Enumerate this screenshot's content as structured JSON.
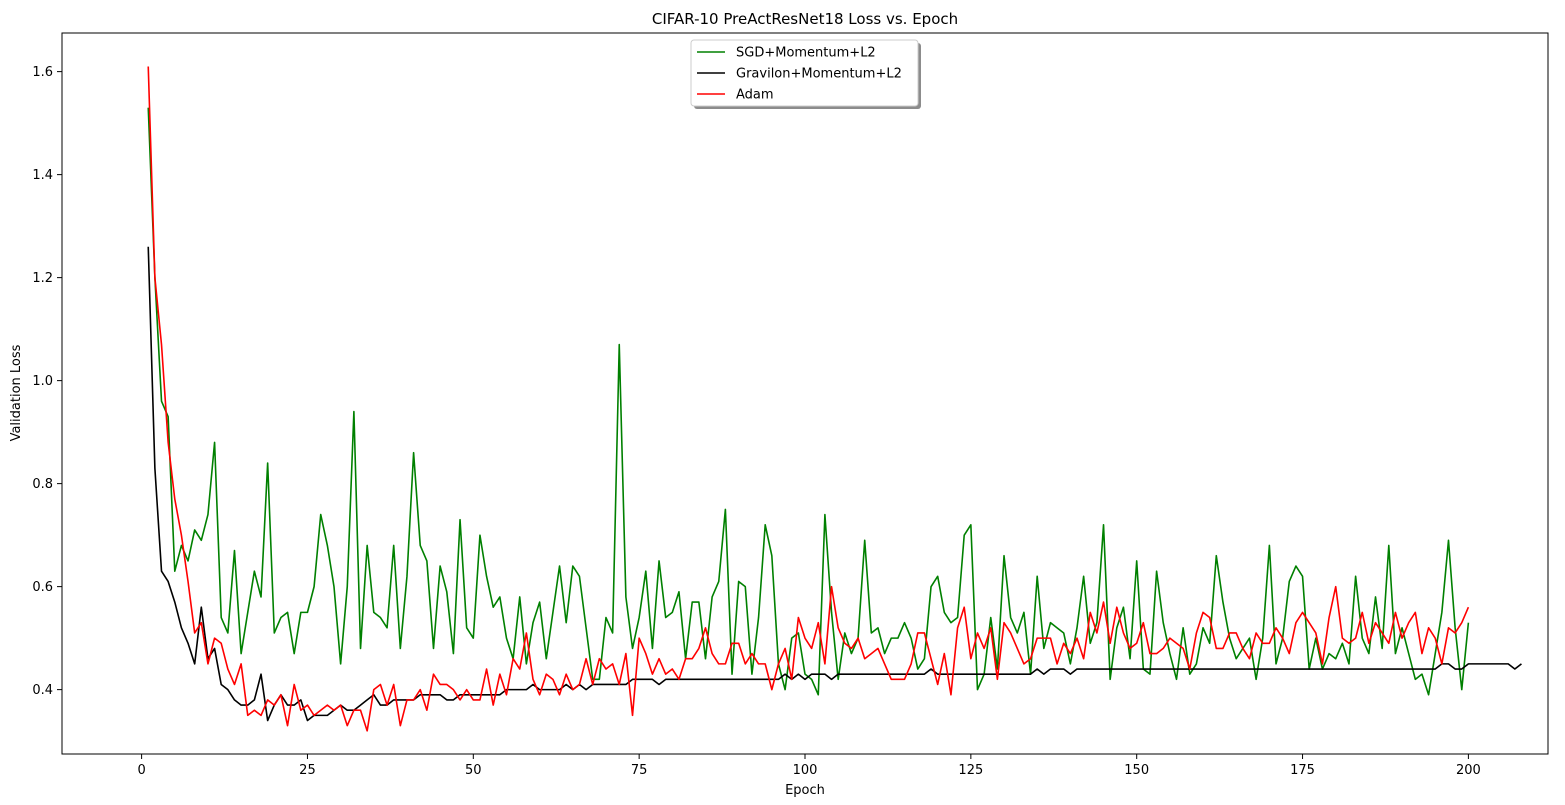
{
  "chart_data": {
    "type": "line",
    "title": "CIFAR-10 PreActResNet18 Loss vs. Epoch",
    "xlabel": "Epoch",
    "ylabel": "Validation Loss",
    "xlim": [
      -12,
      212
    ],
    "ylim": [
      0.275,
      1.675
    ],
    "x_ticks": [
      0,
      25,
      50,
      75,
      100,
      125,
      150,
      175,
      200
    ],
    "y_ticks": [
      0.4,
      0.6,
      0.8,
      1.0,
      1.2,
      1.4,
      1.6
    ],
    "grid": false,
    "legend_position": "upper-center",
    "series": [
      {
        "name": "SGD+Momentum+L2",
        "color": "#008000",
        "x_start": 1,
        "values": [
          1.53,
          1.2,
          0.96,
          0.93,
          0.63,
          0.68,
          0.65,
          0.71,
          0.69,
          0.74,
          0.88,
          0.54,
          0.51,
          0.67,
          0.47,
          0.55,
          0.63,
          0.58,
          0.84,
          0.51,
          0.54,
          0.55,
          0.47,
          0.55,
          0.55,
          0.6,
          0.74,
          0.68,
          0.6,
          0.45,
          0.6,
          0.94,
          0.48,
          0.68,
          0.55,
          0.54,
          0.52,
          0.68,
          0.48,
          0.62,
          0.86,
          0.68,
          0.65,
          0.48,
          0.64,
          0.59,
          0.47,
          0.73,
          0.52,
          0.5,
          0.7,
          0.62,
          0.56,
          0.58,
          0.5,
          0.46,
          0.58,
          0.45,
          0.53,
          0.57,
          0.46,
          0.55,
          0.64,
          0.53,
          0.64,
          0.62,
          0.52,
          0.42,
          0.42,
          0.54,
          0.51,
          1.07,
          0.58,
          0.48,
          0.54,
          0.63,
          0.48,
          0.65,
          0.54,
          0.55,
          0.59,
          0.46,
          0.57,
          0.57,
          0.46,
          0.58,
          0.61,
          0.75,
          0.43,
          0.61,
          0.6,
          0.43,
          0.54,
          0.72,
          0.66,
          0.45,
          0.4,
          0.5,
          0.51,
          0.43,
          0.42,
          0.39,
          0.74,
          0.55,
          0.42,
          0.51,
          0.47,
          0.5,
          0.69,
          0.51,
          0.52,
          0.47,
          0.5,
          0.5,
          0.53,
          0.5,
          0.44,
          0.46,
          0.6,
          0.62,
          0.55,
          0.53,
          0.54,
          0.7,
          0.72,
          0.4,
          0.43,
          0.54,
          0.44,
          0.66,
          0.54,
          0.51,
          0.55,
          0.43,
          0.62,
          0.48,
          0.53,
          0.52,
          0.51,
          0.45,
          0.52,
          0.62,
          0.49,
          0.53,
          0.72,
          0.42,
          0.52,
          0.56,
          0.46,
          0.65,
          0.44,
          0.43,
          0.63,
          0.53,
          0.47,
          0.42,
          0.52,
          0.43,
          0.45,
          0.52,
          0.49,
          0.66,
          0.57,
          0.5,
          0.46,
          0.48,
          0.5,
          0.42,
          0.5,
          0.68,
          0.45,
          0.5,
          0.61,
          0.64,
          0.62,
          0.44,
          0.5,
          0.44,
          0.47,
          0.46,
          0.49,
          0.45,
          0.62,
          0.5,
          0.47,
          0.58,
          0.48,
          0.68,
          0.47,
          0.52,
          0.47,
          0.42,
          0.43,
          0.39,
          0.47,
          0.55,
          0.69,
          0.52,
          0.4,
          0.53
        ]
      },
      {
        "name": "Gravilon+Momentum+L2",
        "color": "#000000",
        "x_start": 1,
        "values": [
          1.26,
          0.83,
          0.63,
          0.61,
          0.57,
          0.52,
          0.49,
          0.45,
          0.56,
          0.46,
          0.48,
          0.41,
          0.4,
          0.38,
          0.37,
          0.37,
          0.38,
          0.43,
          0.34,
          0.37,
          0.39,
          0.37,
          0.37,
          0.38,
          0.34,
          0.35,
          0.35,
          0.35,
          0.36,
          0.37,
          0.36,
          0.36,
          0.37,
          0.38,
          0.39,
          0.37,
          0.37,
          0.38,
          0.38,
          0.38,
          0.38,
          0.39,
          0.39,
          0.39,
          0.39,
          0.38,
          0.38,
          0.39,
          0.39,
          0.39,
          0.39,
          0.39,
          0.39,
          0.39,
          0.4,
          0.4,
          0.4,
          0.4,
          0.41,
          0.4,
          0.4,
          0.4,
          0.4,
          0.41,
          0.4,
          0.41,
          0.4,
          0.41,
          0.41,
          0.41,
          0.41,
          0.41,
          0.41,
          0.42,
          0.42,
          0.42,
          0.42,
          0.41,
          0.42,
          0.42,
          0.42,
          0.42,
          0.42,
          0.42,
          0.42,
          0.42,
          0.42,
          0.42,
          0.42,
          0.42,
          0.42,
          0.42,
          0.42,
          0.42,
          0.42,
          0.42,
          0.43,
          0.42,
          0.43,
          0.42,
          0.43,
          0.43,
          0.43,
          0.42,
          0.43,
          0.43,
          0.43,
          0.43,
          0.43,
          0.43,
          0.43,
          0.43,
          0.43,
          0.43,
          0.43,
          0.43,
          0.43,
          0.43,
          0.44,
          0.43,
          0.43,
          0.43,
          0.43,
          0.43,
          0.43,
          0.43,
          0.43,
          0.43,
          0.43,
          0.43,
          0.43,
          0.43,
          0.43,
          0.43,
          0.44,
          0.43,
          0.44,
          0.44,
          0.44,
          0.43,
          0.44,
          0.44,
          0.44,
          0.44,
          0.44,
          0.44,
          0.44,
          0.44,
          0.44,
          0.44,
          0.44,
          0.44,
          0.44,
          0.44,
          0.44,
          0.44,
          0.44,
          0.44,
          0.44,
          0.44,
          0.44,
          0.44,
          0.44,
          0.44,
          0.44,
          0.44,
          0.44,
          0.44,
          0.44,
          0.44,
          0.44,
          0.44,
          0.44,
          0.44,
          0.44,
          0.44,
          0.44,
          0.44,
          0.44,
          0.44,
          0.44,
          0.44,
          0.44,
          0.44,
          0.44,
          0.44,
          0.44,
          0.44,
          0.44,
          0.44,
          0.44,
          0.44,
          0.44,
          0.44,
          0.44,
          0.45,
          0.45,
          0.44,
          0.44,
          0.45,
          0.45,
          0.45,
          0.45,
          0.45,
          0.45,
          0.45,
          0.44,
          0.45
        ]
      },
      {
        "name": "Adam",
        "color": "#ff0000",
        "x_start": 1,
        "values": [
          1.61,
          1.2,
          1.07,
          0.88,
          0.77,
          0.7,
          0.61,
          0.51,
          0.53,
          0.45,
          0.5,
          0.49,
          0.44,
          0.41,
          0.45,
          0.35,
          0.36,
          0.35,
          0.38,
          0.37,
          0.39,
          0.33,
          0.41,
          0.36,
          0.37,
          0.35,
          0.36,
          0.37,
          0.36,
          0.37,
          0.33,
          0.36,
          0.36,
          0.32,
          0.4,
          0.41,
          0.37,
          0.41,
          0.33,
          0.38,
          0.38,
          0.4,
          0.36,
          0.43,
          0.41,
          0.41,
          0.4,
          0.38,
          0.4,
          0.38,
          0.38,
          0.44,
          0.37,
          0.43,
          0.39,
          0.46,
          0.44,
          0.51,
          0.42,
          0.39,
          0.43,
          0.42,
          0.39,
          0.43,
          0.4,
          0.41,
          0.46,
          0.41,
          0.46,
          0.44,
          0.45,
          0.41,
          0.47,
          0.35,
          0.5,
          0.47,
          0.43,
          0.46,
          0.43,
          0.44,
          0.42,
          0.46,
          0.46,
          0.48,
          0.52,
          0.47,
          0.45,
          0.45,
          0.49,
          0.49,
          0.45,
          0.47,
          0.45,
          0.45,
          0.4,
          0.45,
          0.48,
          0.42,
          0.54,
          0.5,
          0.48,
          0.53,
          0.45,
          0.6,
          0.52,
          0.49,
          0.48,
          0.5,
          0.46,
          0.47,
          0.48,
          0.45,
          0.42,
          0.42,
          0.42,
          0.45,
          0.51,
          0.51,
          0.46,
          0.41,
          0.47,
          0.39,
          0.52,
          0.56,
          0.46,
          0.51,
          0.48,
          0.52,
          0.42,
          0.53,
          0.51,
          0.48,
          0.45,
          0.46,
          0.5,
          0.5,
          0.5,
          0.45,
          0.49,
          0.47,
          0.5,
          0.46,
          0.55,
          0.51,
          0.57,
          0.49,
          0.56,
          0.51,
          0.48,
          0.49,
          0.53,
          0.47,
          0.47,
          0.48,
          0.5,
          0.49,
          0.48,
          0.44,
          0.51,
          0.55,
          0.54,
          0.48,
          0.48,
          0.51,
          0.51,
          0.48,
          0.46,
          0.51,
          0.49,
          0.49,
          0.52,
          0.5,
          0.47,
          0.53,
          0.55,
          0.53,
          0.51,
          0.45,
          0.54,
          0.6,
          0.5,
          0.49,
          0.5,
          0.55,
          0.49,
          0.53,
          0.51,
          0.49,
          0.55,
          0.5,
          0.53,
          0.55,
          0.47,
          0.52,
          0.5,
          0.45,
          0.52,
          0.51,
          0.53,
          0.56
        ]
      }
    ]
  }
}
